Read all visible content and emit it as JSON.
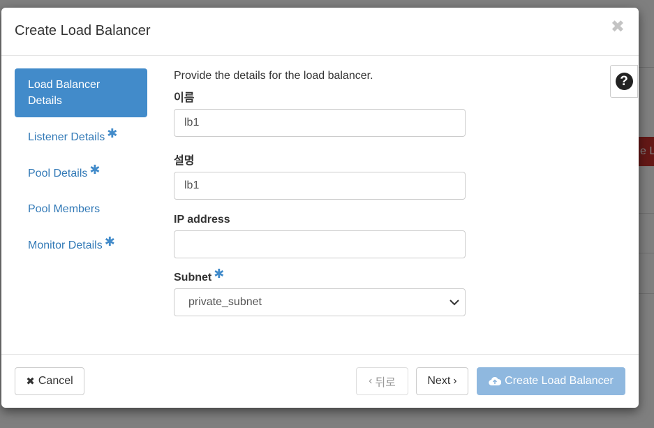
{
  "modal": {
    "title": "Create Load Balancer",
    "close_icon": "close-icon"
  },
  "nav": {
    "items": [
      {
        "label": "Load Balancer Details",
        "required": false,
        "active": true
      },
      {
        "label": "Listener Details",
        "required": true,
        "active": false
      },
      {
        "label": "Pool Details",
        "required": true,
        "active": false
      },
      {
        "label": "Pool Members",
        "required": false,
        "active": false
      },
      {
        "label": "Monitor Details",
        "required": true,
        "active": false
      }
    ],
    "required_marker": "✱"
  },
  "form": {
    "intro": "Provide the details for the load balancer.",
    "name": {
      "label": "이름",
      "value": "lb1"
    },
    "description": {
      "label": "설명",
      "value": "lb1"
    },
    "ip_address": {
      "label": "IP address",
      "value": ""
    },
    "subnet": {
      "label": "Subnet",
      "selected": "private_subnet"
    }
  },
  "footer": {
    "cancel_label": "Cancel",
    "back_label": "뒤로",
    "next_label": "Next",
    "create_label": "Create Load Balancer"
  },
  "colors": {
    "accent": "#428bca",
    "link": "#337ab7",
    "create_disabled": "#8fb8df"
  }
}
